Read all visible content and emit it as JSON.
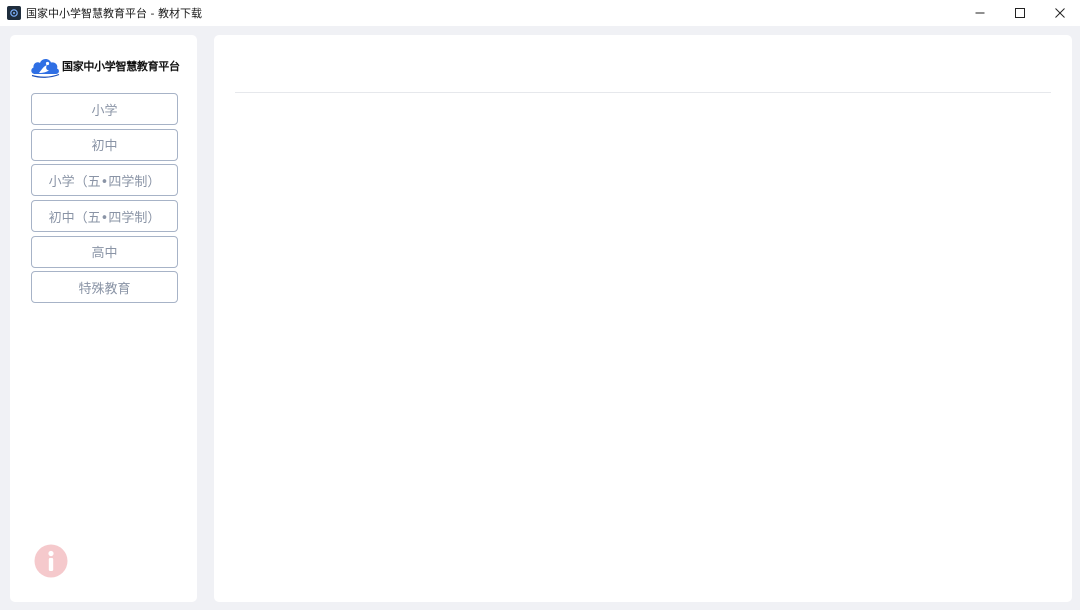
{
  "window": {
    "title": "国家中小学智慧教育平台 - 教材下载",
    "icon": "app-icon",
    "controls": [
      "minimize-icon",
      "maximize-icon",
      "close-icon"
    ]
  },
  "sidebar": {
    "logo_text": "国家中小学智慧教育平台",
    "items": [
      {
        "label": "小学"
      },
      {
        "label": "初中"
      },
      {
        "label": "小学（五•四学制）"
      },
      {
        "label": "初中（五•四学制）"
      },
      {
        "label": "高中"
      },
      {
        "label": "特殊教育"
      }
    ],
    "info_icon": "info-icon"
  },
  "colors": {
    "button_border": "#a7b3c7",
    "button_text": "#8a94a6",
    "logo_blue": "#2f6fe4",
    "info_icon": "#f5c9cc",
    "background": "#f0f1f5"
  }
}
